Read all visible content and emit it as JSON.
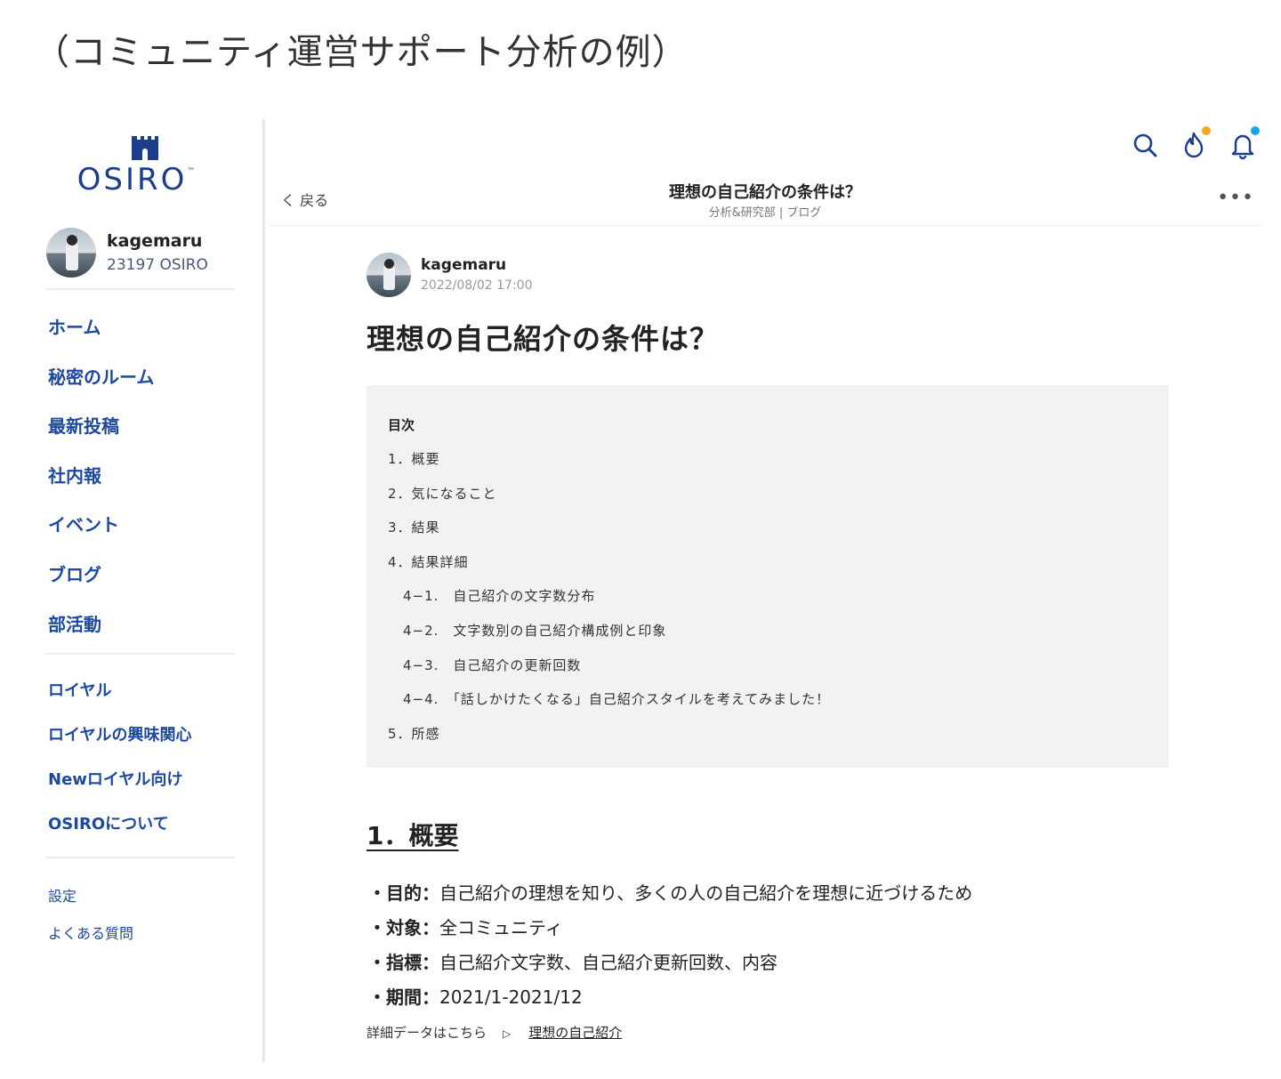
{
  "caption": "（コミュニティ運営サポート分析の例）",
  "sidebar": {
    "logo_text": "OSIRO",
    "logo_tm": "™",
    "profile": {
      "name": "kagemaru",
      "score": "23197 OSIRO"
    },
    "nav_main": [
      "ホーム",
      "秘密のルーム",
      "最新投稿",
      "社内報",
      "イベント",
      "ブログ",
      "部活動"
    ],
    "nav_royal": [
      "ロイヤル",
      "ロイヤルの興味関心",
      "Newロイヤル向け",
      "OSIROについて"
    ],
    "nav_misc": [
      "設定",
      "よくある質問"
    ]
  },
  "header": {
    "back": "く 戻る",
    "title": "理想の自己紹介の条件は？",
    "subtitle": "分析&研究部 | ブログ",
    "more": "•••",
    "icons": {
      "search": "search-icon",
      "fire": "fire-icon",
      "bell": "bell-icon"
    },
    "colors": {
      "brand": "#1d3c8c",
      "nav": "#1d4aa0",
      "fire_dot": "#f5a623",
      "bell_dot": "#1aa3e8"
    }
  },
  "post": {
    "author": "kagemaru",
    "date": "2022/08/02 17:00",
    "title": "理想の自己紹介の条件は？",
    "toc_heading": "目次",
    "toc": [
      {
        "label": "1．概要",
        "sub": false
      },
      {
        "label": "2．気になること",
        "sub": false
      },
      {
        "label": "3．結果",
        "sub": false
      },
      {
        "label": "4．結果詳細",
        "sub": false
      },
      {
        "label": "4−1.　自己紹介の文字数分布",
        "sub": true
      },
      {
        "label": "4−2.　文字数別の自己紹介構成例と印象",
        "sub": true
      },
      {
        "label": "4−3.　自己紹介の更新回数",
        "sub": true
      },
      {
        "label": "4−4.　「話しかけたくなる」自己紹介スタイルを考えてみました！",
        "sub": true
      },
      {
        "label": "5．所感",
        "sub": false
      }
    ],
    "section_heading": "1．概要",
    "bullets": [
      {
        "key": "・目的：",
        "value": "自己紹介の理想を知り、多くの人の自己紹介を理想に近づけるため"
      },
      {
        "key": "・対象：",
        "value": "全コミュニティ"
      },
      {
        "key": "・指標：",
        "value": "自己紹介文字数、自己紹介更新回数、内容"
      },
      {
        "key": "・期間：",
        "value": "2021/1-2021/12"
      }
    ],
    "detail_text": "詳細データはこちら",
    "detail_arrow": "▷",
    "detail_link": "理想の自己紹介"
  }
}
